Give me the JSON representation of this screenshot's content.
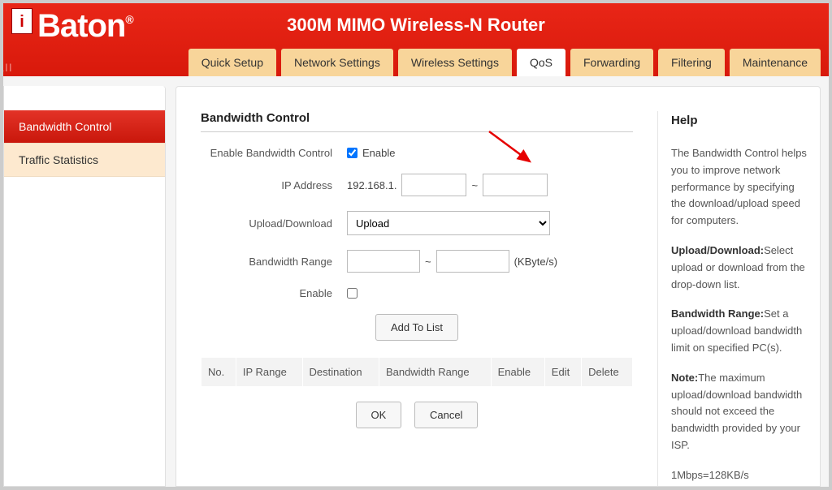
{
  "header": {
    "brand_i": "i",
    "brand_ball": "ball",
    "brand_main": "Baton",
    "brand_reg": "®",
    "product_title": "300M MIMO Wireless-N Router"
  },
  "tabs": [
    {
      "label": "Quick Setup",
      "active": false
    },
    {
      "label": "Network Settings",
      "active": false
    },
    {
      "label": "Wireless Settings",
      "active": false
    },
    {
      "label": "QoS",
      "active": true
    },
    {
      "label": "Forwarding",
      "active": false
    },
    {
      "label": "Filtering",
      "active": false
    },
    {
      "label": "Maintenance",
      "active": false
    }
  ],
  "sidebar": {
    "items": [
      {
        "label": "Bandwidth Control",
        "active": true
      },
      {
        "label": "Traffic Statistics",
        "active": false
      }
    ]
  },
  "content": {
    "section_title": "Bandwidth Control",
    "labels": {
      "enable_bw": "Enable Bandwidth Control",
      "enable_cb": "Enable",
      "ip_address": "IP Address",
      "ip_prefix": "192.168.1.",
      "up_down": "Upload/Download",
      "bw_range": "Bandwidth Range",
      "bw_unit": "(KByte/s)",
      "enable_row": "Enable",
      "add_btn": "Add To List",
      "ok_btn": "OK",
      "cancel_btn": "Cancel"
    },
    "select_options": [
      "Upload"
    ],
    "select_value": "Upload",
    "enable_bw_checked": true,
    "enable_row_checked": false,
    "table_headers": [
      "No.",
      "IP Range",
      "Destination",
      "Bandwidth Range",
      "Enable",
      "Edit",
      "Delete"
    ]
  },
  "help": {
    "title": "Help",
    "p1": "The Bandwidth Control helps you to improve network performance by specifying the download/upload speed for computers.",
    "p2_b": "Upload/Download:",
    "p2": "Select upload or download from the drop-down list.",
    "p3_b": "Bandwidth Range:",
    "p3": "Set a upload/download bandwidth limit on specified PC(s).",
    "p4_b": "Note:",
    "p4": "The maximum upload/download bandwidth should not exceed the bandwidth provided by your ISP.",
    "p5": "1Mbps=128KB/s"
  }
}
